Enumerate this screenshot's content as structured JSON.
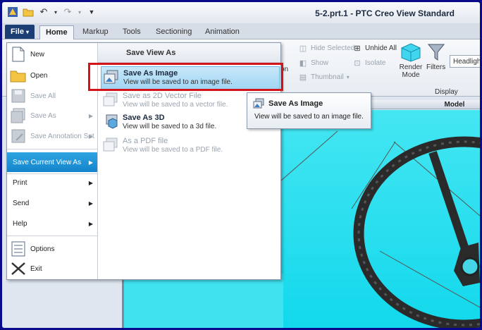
{
  "window": {
    "title": "5-2.prt.1 - PTC Creo View Standard"
  },
  "quick_access": {
    "icons": [
      "app-icon",
      "open-folder-icon",
      "undo-icon",
      "redo-icon",
      "customize-icon"
    ]
  },
  "tabs": {
    "file": "File",
    "home": "Home",
    "markup": "Markup",
    "tools": "Tools",
    "sectioning": "Sectioning",
    "animation": "Animation"
  },
  "ribbon": {
    "partial_label": "on",
    "hide_selected": "Hide Selected",
    "unhide_all": "Unhide All",
    "show": "Show",
    "isolate": "Isolate",
    "thumbnail": "Thumbnail",
    "render_mode": "Render Mode",
    "filters": "Filters",
    "headlights": "Headlight",
    "group_display": "Display",
    "view_header": "Model"
  },
  "file_menu": {
    "items": [
      {
        "label": "New",
        "enabled": true
      },
      {
        "label": "Open",
        "enabled": true
      },
      {
        "label": "Save All",
        "enabled": false
      },
      {
        "label": "Save As",
        "enabled": false
      },
      {
        "label": "Save Annotation Set",
        "enabled": false
      },
      {
        "label": "Save Current View As",
        "enabled": true
      },
      {
        "label": "Print",
        "enabled": true
      },
      {
        "label": "Send",
        "enabled": true
      },
      {
        "label": "Help",
        "enabled": true
      },
      {
        "label": "Options",
        "enabled": true
      },
      {
        "label": "Exit",
        "enabled": true
      }
    ],
    "submenu_title": "Save View As",
    "submenu": [
      {
        "title": "Save As Image",
        "desc": "View will be saved to an image file.",
        "enabled": true
      },
      {
        "title": "Save as 2D Vector File",
        "desc": "View will be saved to a vector file.",
        "enabled": false
      },
      {
        "title": "Save As 3D",
        "desc": "View will be saved to a 3d file.",
        "enabled": true
      },
      {
        "title": "As a PDF file",
        "desc": "View will be saved to a PDF file.",
        "enabled": false
      }
    ]
  },
  "tooltip": {
    "title": "Save As Image",
    "desc": "View will be saved to an image file."
  },
  "colors": {
    "accent": "#1b3f75",
    "selection": "#1584cc",
    "highlight_box": "#d4141b",
    "viewport": "#2fe0ef"
  }
}
